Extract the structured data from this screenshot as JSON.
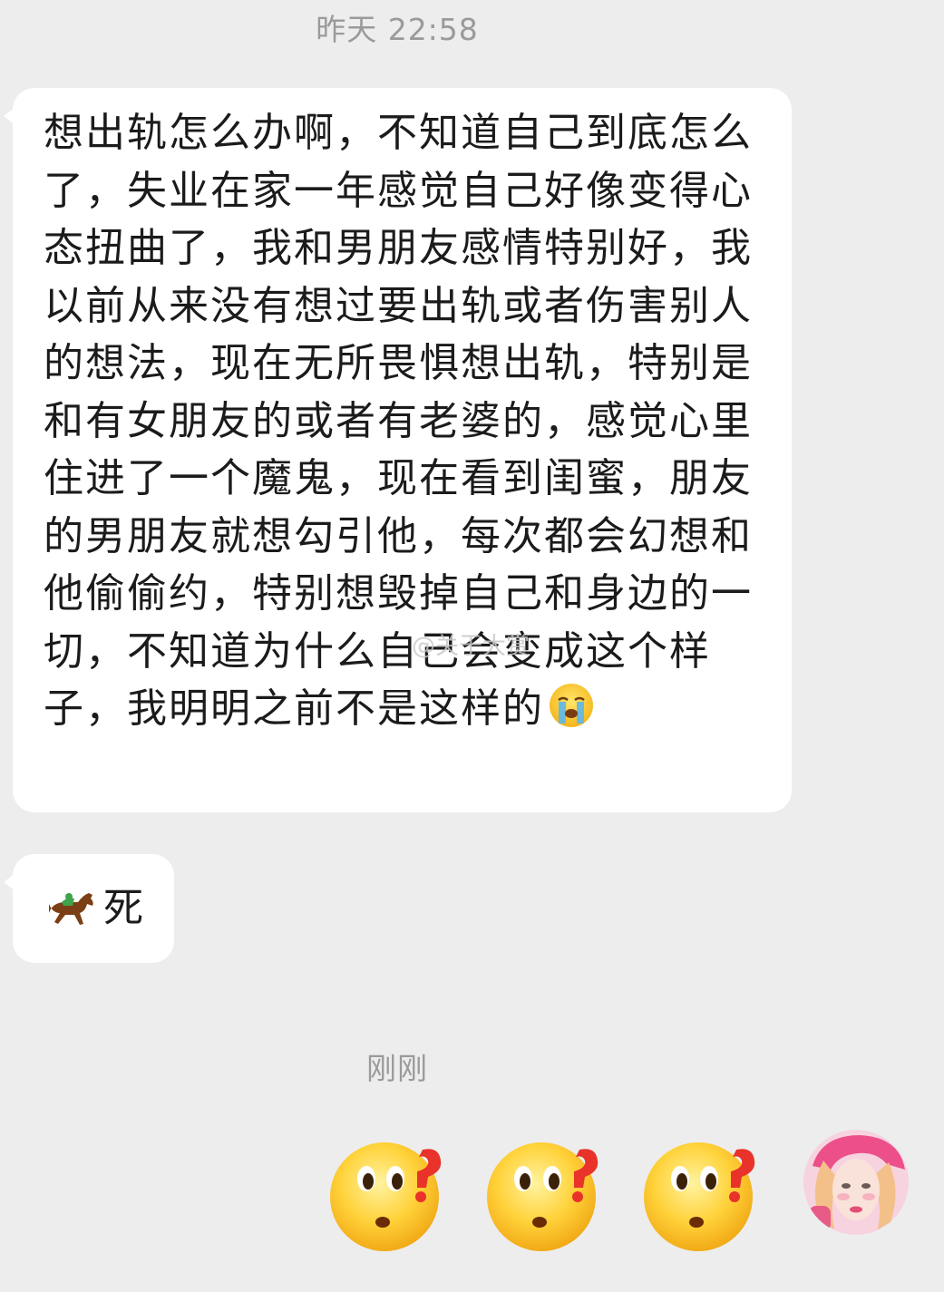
{
  "chat": {
    "timestamp_top": "昨天 22:58",
    "timestamp_bottom": "刚刚",
    "messages": [
      {
        "sender": "other",
        "text": "想出轨怎么办啊，不知道自己到底怎么了，失业在家一年感觉自己好像变得心态扭曲了，我和男朋友感情特别好，我以前从来没有想过要出轨或者伤害别人的想法，现在无所畏惧想出轨，特别是和有女朋友的或者有老婆的，感觉心里住进了一个魔鬼，现在看到闺蜜，朋友的男朋友就想勾引他，每次都会幻想和他偷偷约，特别想毁掉自己和身边的一切，不知道为什么自己会变成这个样子，我明明之前不是这样的",
        "emoji": "loudly-crying-face-icon"
      },
      {
        "sender": "other",
        "text": "死",
        "emoji": "horse-racing-icon"
      }
    ],
    "reply_stickers": [
      "confused-face-sticker",
      "confused-face-sticker",
      "confused-face-sticker"
    ],
    "watermark": "@关于大赏"
  },
  "colors": {
    "background": "#ededed",
    "bubble": "#ffffff",
    "timestamp": "#9a9a9a",
    "text": "#1b1b1b"
  }
}
